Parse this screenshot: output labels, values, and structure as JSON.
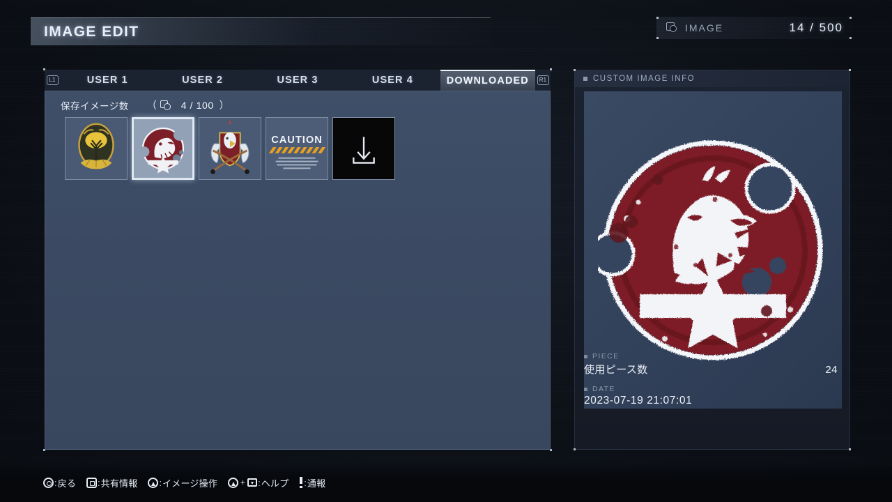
{
  "header": {
    "title": "IMAGE EDIT",
    "counter": {
      "icon": "image-icon",
      "label": "IMAGE",
      "value": "14 / 500"
    }
  },
  "tabs": {
    "left_shoulder": "L1",
    "right_shoulder": "R1",
    "items": [
      {
        "label": "USER 1",
        "active": false
      },
      {
        "label": "USER 2",
        "active": false
      },
      {
        "label": "USER 3",
        "active": false
      },
      {
        "label": "USER 4",
        "active": false
      },
      {
        "label": "DOWNLOADED",
        "active": true
      }
    ]
  },
  "gallery": {
    "count_label": "保存イメージ数",
    "count_open": "（",
    "count_close": "）",
    "count_value": "4 / 100",
    "thumbnails": [
      {
        "name": "gold-tree-emblem",
        "selected": false
      },
      {
        "name": "diamond-dogs-emblem",
        "selected": true
      },
      {
        "name": "heraldic-crest-emblem",
        "selected": false
      },
      {
        "name": "caution-banner-emblem",
        "selected": false
      },
      {
        "name": "download-slot",
        "selected": false
      }
    ],
    "caution_text": "CAUTION"
  },
  "info_panel": {
    "header": "CUSTOM IMAGE INFO",
    "preview_name": "diamond-dogs-emblem",
    "piece": {
      "section": "PIECE",
      "label": "使用ピース数",
      "value": "24"
    },
    "date": {
      "section": "DATE",
      "value": "2023-07-19 21:07:01"
    }
  },
  "footer": {
    "hints": [
      {
        "icon": "circle-button-icon",
        "colon": ":",
        "text": "戻る"
      },
      {
        "icon": "square-button-icon",
        "colon": ":",
        "text": "共有情報"
      },
      {
        "icon": "triangle-button-icon",
        "colon": ":",
        "text": "イメージ操作"
      },
      {
        "icon": "triangle-plus-dpad-icon",
        "colon": ":",
        "text": "ヘルプ"
      },
      {
        "icon": "report-icon",
        "colon": ":",
        "text": "通報"
      }
    ]
  },
  "colors": {
    "accent_red": "#7d1f28",
    "panel_blue": "#3b4a62",
    "background": "#0c1017",
    "text_light": "#e8eef6"
  }
}
